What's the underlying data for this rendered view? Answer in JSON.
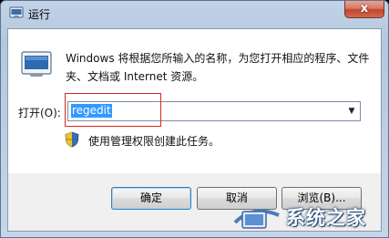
{
  "window": {
    "title": "运行",
    "close_label": "x"
  },
  "main": {
    "description": "Windows 将根据您所输入的名称，为您打开相应的程序、文件夹、文档或 Internet 资源。",
    "open_label": "打开(O):",
    "open_value": "regedit",
    "admin_note": "使用管理权限创建此任务。"
  },
  "buttons": {
    "ok": "确定",
    "cancel": "取消",
    "browse": "浏览(B)..."
  },
  "watermark": {
    "text": "系统之家"
  },
  "icons": [
    "run-icon",
    "shield-icon",
    "chevron-down-icon",
    "close-icon"
  ],
  "colors": {
    "selection": "#3399ff",
    "highlight_box": "#d9261c",
    "close_button": "#c2452c"
  }
}
